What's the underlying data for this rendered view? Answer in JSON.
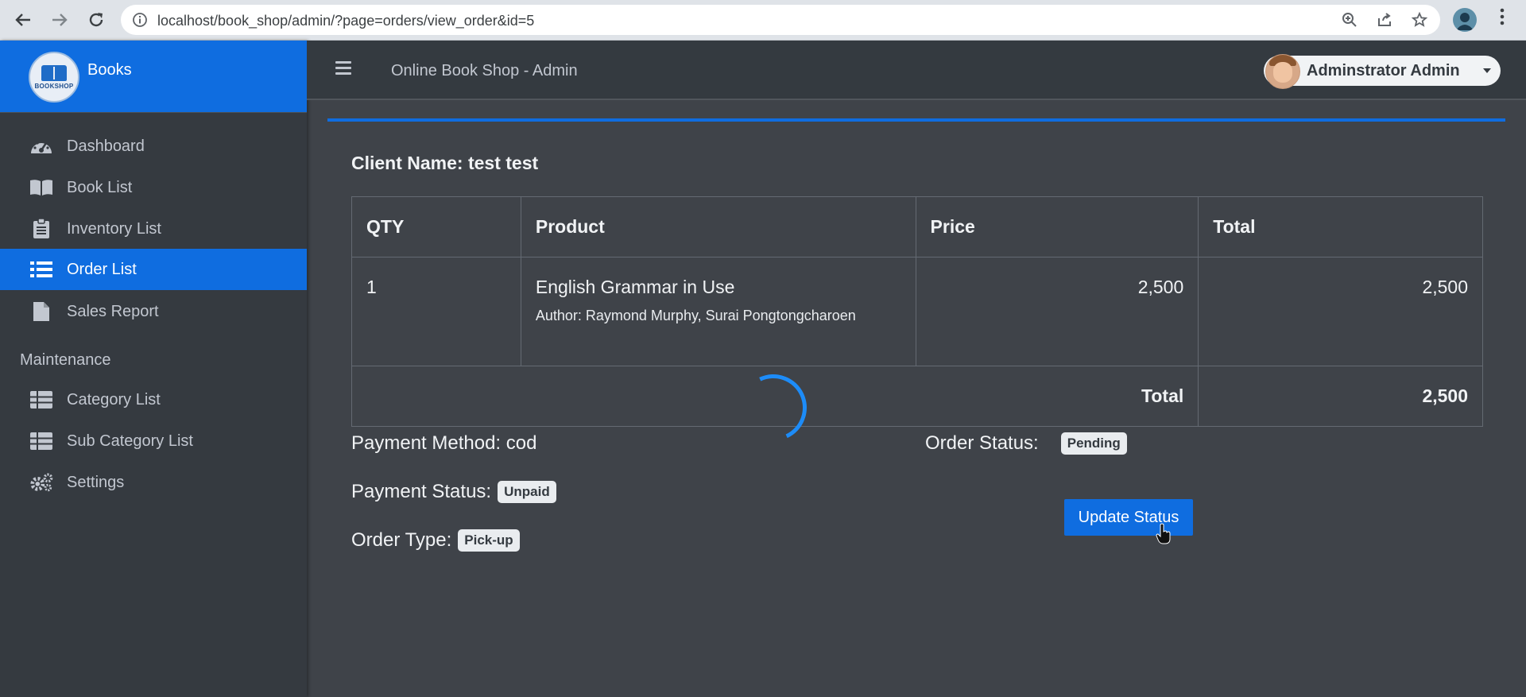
{
  "browser": {
    "url": "localhost/book_shop/admin/?page=orders/view_order&id=5",
    "back_icon": "arrow-left",
    "forward_icon": "arrow-right",
    "reload_icon": "reload",
    "zoom_icon": "zoom-in",
    "share_icon": "share",
    "star_icon": "star",
    "profile_icon": "account",
    "menu_icon": "more-vertical"
  },
  "sidebar": {
    "brand": {
      "logo_text": "BOOKSHOP",
      "name": "Books"
    },
    "items": [
      {
        "label": "Dashboard",
        "icon": "tachometer",
        "active": false
      },
      {
        "label": "Book List",
        "icon": "book-open",
        "active": false
      },
      {
        "label": "Inventory List",
        "icon": "clipboard",
        "active": false
      },
      {
        "label": "Order List",
        "icon": "list",
        "active": true
      },
      {
        "label": "Sales Report",
        "icon": "file",
        "active": false
      }
    ],
    "maintenance": {
      "header": "Maintenance",
      "items": [
        {
          "label": "Category List",
          "icon": "table"
        },
        {
          "label": "Sub Category List",
          "icon": "table"
        },
        {
          "label": "Settings",
          "icon": "cogs"
        }
      ]
    }
  },
  "topbar": {
    "title": "Online Book Shop - Admin",
    "user_name": "Adminstrator Admin",
    "menu_icon": "bars"
  },
  "order": {
    "client_label": "Client Name: test test",
    "table": {
      "headers": [
        "QTY",
        "Product",
        "Price",
        "Total"
      ],
      "rows": [
        {
          "qty": "1",
          "product": "English Grammar in Use",
          "author": "Author: Raymond Murphy, Surai Pongtongcharoen",
          "price": "2,500",
          "total": "2,500"
        }
      ],
      "footer_label": "Total",
      "footer_value": "2,500"
    },
    "payment_method": "Payment Method: cod",
    "payment_status_label": "Payment Status:",
    "payment_status": "Unpaid",
    "order_type_label": "Order Type:",
    "order_type": "Pick-up",
    "order_status_label": "Order Status:",
    "order_status": "Pending",
    "update_button": "Update Status"
  },
  "colors": {
    "accent": "#0f6de0",
    "sidebar_bg": "#353a40",
    "content_bg": "#3f4349"
  }
}
